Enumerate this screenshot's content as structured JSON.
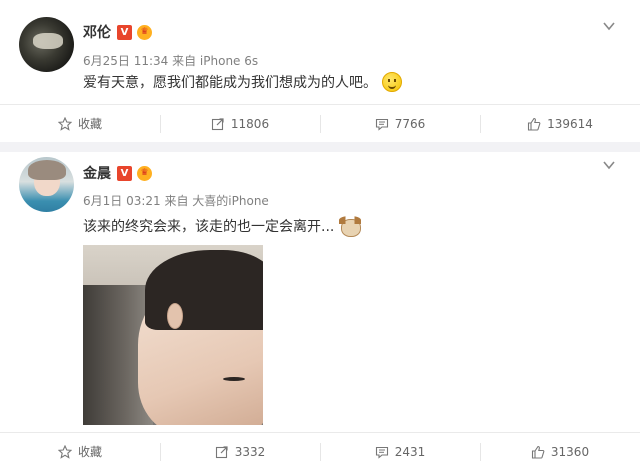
{
  "posts": [
    {
      "author": "邓伦",
      "verified_badge": "V",
      "meta": "6月25日 11:34 来自 iPhone 6s",
      "text": "爱有天意，愿我们都能成为我们想成为的人吧。",
      "emoji": "smile-emoji",
      "actions": {
        "favorite": "收藏",
        "repost": "11806",
        "comment": "7766",
        "like": "139614"
      }
    },
    {
      "author": "金晨",
      "verified_badge": "V",
      "meta": "6月1日 03:21 来自 大喜的iPhone",
      "text": "该来的终究会来，该走的也一定会离开...",
      "emoji": "dog-emoji",
      "actions": {
        "favorite": "收藏",
        "repost": "3332",
        "comment": "2431",
        "like": "31360"
      }
    }
  ],
  "colors": {
    "verified": "#e8452c",
    "meta_text": "#808080",
    "separator": "#f2f2f5"
  },
  "icons": [
    "star-icon",
    "repost-icon",
    "comment-icon",
    "like-icon",
    "chevron-down-icon"
  ]
}
